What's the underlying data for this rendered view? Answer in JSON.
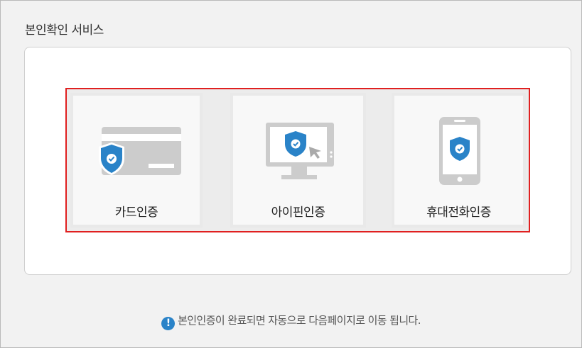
{
  "page": {
    "section_title": "본인확인 서비스"
  },
  "options": [
    {
      "label": "카드인증",
      "icon": "credit-card-shield-icon"
    },
    {
      "label": "아이핀인증",
      "icon": "monitor-shield-icon"
    },
    {
      "label": "휴대전화인증",
      "icon": "smartphone-shield-icon"
    }
  ],
  "notice": {
    "icon": "info-icon",
    "icon_glyph": "!",
    "text": "본인인증이 완료되면 자동으로 다음페이지로 이동 됩니다."
  },
  "colors": {
    "highlight_border": "#e02020",
    "shield": "#2a83c8",
    "icon_gray": "#cccccc"
  }
}
